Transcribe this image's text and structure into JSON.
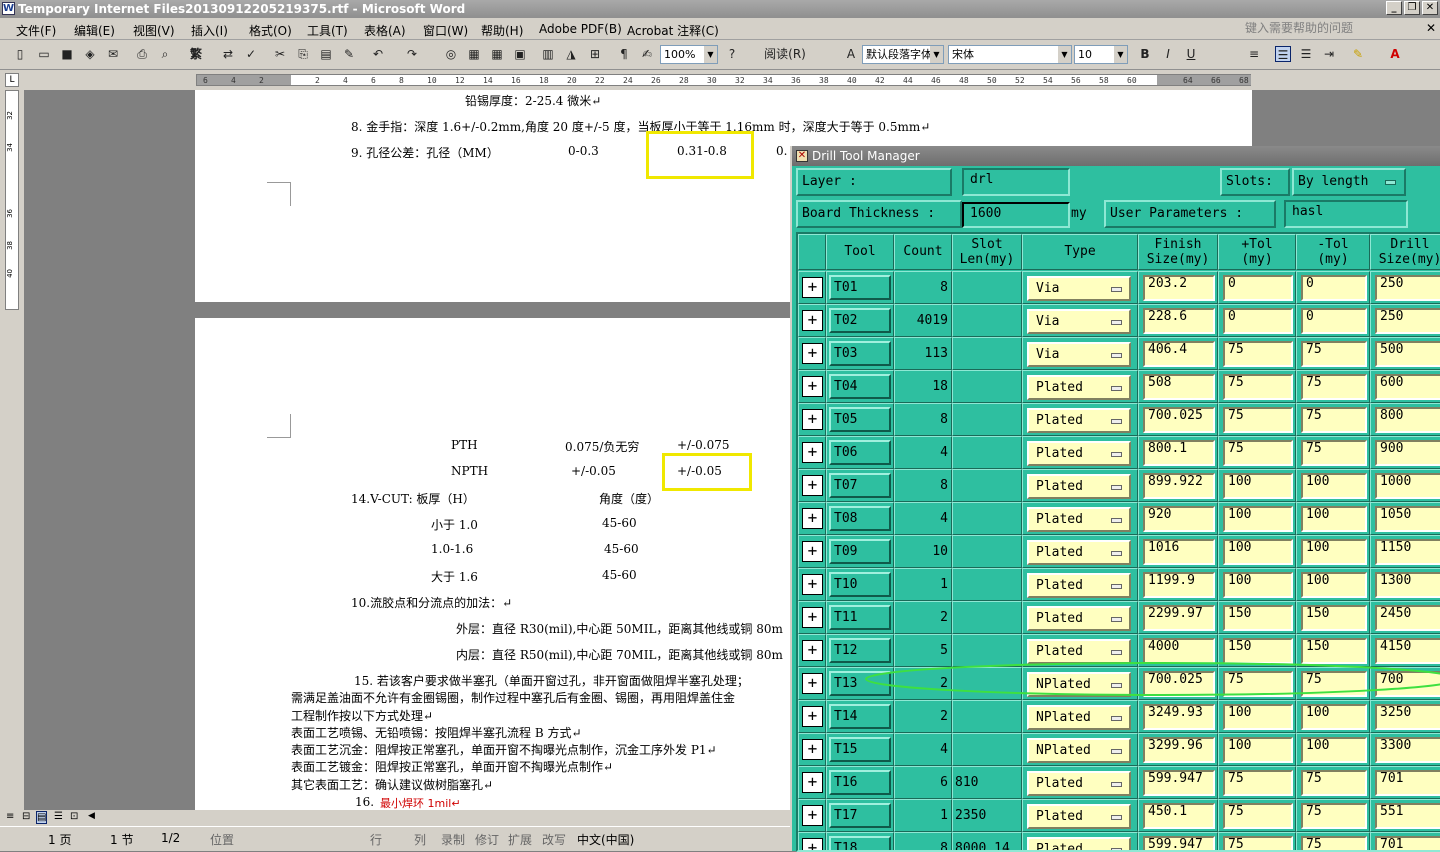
{
  "window": {
    "title": "Temporary Internet Files20130912205219375.rtf - Microsoft Word"
  },
  "menu": {
    "items": [
      "文件(F)",
      "编辑(E)",
      "视图(V)",
      "插入(I)",
      "格式(O)",
      "工具(T)",
      "表格(A)",
      "窗口(W)",
      "帮助(H)",
      "Adobe PDF(B)",
      "Acrobat 注释(C)"
    ],
    "help_placeholder": "键入需要帮助的问题"
  },
  "toolbar": {
    "zoom": "100%",
    "read_label": "阅读(R)",
    "style": "默认段落字体",
    "font": "宋体",
    "size": "10",
    "size2": "10",
    "fanti": "繁"
  },
  "ruler": {
    "ticks": [
      "6",
      "4",
      "2",
      "2",
      "4",
      "6",
      "8",
      "10",
      "12",
      "14",
      "16",
      "18",
      "20",
      "22",
      "24",
      "26",
      "28",
      "30",
      "32",
      "34",
      "36",
      "38",
      "40",
      "42",
      "44",
      "46",
      "48",
      "50",
      "52",
      "54",
      "56",
      "58",
      "60",
      "64",
      "66",
      "68"
    ]
  },
  "vruler": {
    "ticks": [
      "32",
      "34",
      "36",
      "38",
      "40",
      "42"
    ]
  },
  "document": {
    "p1_line1": "铅锡厚度：2-25.4 微米↵",
    "p1_line8": "8.  金手指：深度 1.6+/-0.2mm,角度 20 度+/-5 度，当板厚小于等于 1.16mm 时，深度大于等于 0.5mm↵",
    "p1_line9a": "9.  孔径公差：孔径（MM）",
    "p1_line9b": "0-0.3",
    "p1_line9c": "0.31-0.8",
    "p1_line9d": "0.",
    "pth": "PTH",
    "pth_val": "0.075/负无穷",
    "pth_val2": "+/-0.075",
    "npth": "NPTH",
    "npth_val": "+/-0.05",
    "npth_val2": "+/-0.05",
    "vcut": "14.V-CUT:  板厚（H）",
    "vcut_angle": "角度（度）",
    "r1a": "小于 1.0",
    "r1b": "45-60",
    "r2a": "1.0-1.6",
    "r2b": "45-60",
    "r3a": "大于 1.6",
    "r3b": "45-60",
    "l10": "10.流胶点和分流点的加法：↵",
    "l10a": "外层：直径 R30(mil),中心距 50MIL，距离其他线或铜 80m",
    "l10b": "内层：直径 R50(mil),中心距 70MIL，距离其他线或铜 80m",
    "l15": "15.  若该客户要求做半塞孔（单面开窗过孔，非开窗面做阻焊半塞孔处理；",
    "l15a": "需满足盖油面不允许有金圈锡圈，制作过程中塞孔后有金圈、锡圈，再用阻焊盖住金",
    "l15b": "工程制作按以下方式处理↵",
    "l15c": "表面工艺喷锡、无铅喷锡：按阻焊半塞孔流程 B 方式↵",
    "l15d": "表面工艺沉金：阻焊按正常塞孔，单面开窗不掏曝光点制作，沉金工序外发 P1↵",
    "l15e": "表面工艺镀金：阻焊按正常塞孔，单面开窗不掏曝光点制作↵",
    "l15f": "其它表面工艺：确认建议做树脂塞孔↵",
    "l16n": "16.",
    "l16": "最小焊环 1mil↵"
  },
  "status": {
    "page": "1 页",
    "section": "1 节",
    "pages": "1/2",
    "pos": "位置",
    "line": "行",
    "col": "列",
    "rec": "录制",
    "trk": "修订",
    "ext": "扩展",
    "ovr": "改写",
    "lang": "中文(中国)"
  },
  "dtm": {
    "title": "Drill Tool Manager",
    "layer_label": "Layer             :",
    "layer_value": "drl",
    "slots_label": "Slots:",
    "slots_value": "By length",
    "thickness_label": "Board Thickness  :",
    "thickness_value": "1600",
    "thickness_unit": "my",
    "user_params_label": "User Parameters :",
    "user_params_value": "hasl",
    "headers": {
      "tool": "Tool",
      "count": "Count",
      "slot1": "Slot",
      "slot2": "Len(my)",
      "type": "Type",
      "finish1": "Finish",
      "finish2": "Size(my)",
      "ptol1": "+Tol",
      "ptol2": "(my)",
      "mtol1": "-Tol",
      "mtol2": "(my)",
      "drill1": "Drill",
      "drill2": "Size(my)"
    },
    "rows": [
      {
        "tool": "T01",
        "count": "8",
        "slot": "",
        "type": "Via",
        "finish": "203.2",
        "ptol": "0",
        "mtol": "0",
        "drill": "250"
      },
      {
        "tool": "T02",
        "count": "4019",
        "slot": "",
        "type": "Via",
        "finish": "228.6",
        "ptol": "0",
        "mtol": "0",
        "drill": "250"
      },
      {
        "tool": "T03",
        "count": "113",
        "slot": "",
        "type": "Via",
        "finish": "406.4",
        "ptol": "75",
        "mtol": "75",
        "drill": "500"
      },
      {
        "tool": "T04",
        "count": "18",
        "slot": "",
        "type": "Plated",
        "finish": "508",
        "ptol": "75",
        "mtol": "75",
        "drill": "600"
      },
      {
        "tool": "T05",
        "count": "8",
        "slot": "",
        "type": "Plated",
        "finish": "700.025",
        "ptol": "75",
        "mtol": "75",
        "drill": "800"
      },
      {
        "tool": "T06",
        "count": "4",
        "slot": "",
        "type": "Plated",
        "finish": "800.1",
        "ptol": "75",
        "mtol": "75",
        "drill": "900"
      },
      {
        "tool": "T07",
        "count": "8",
        "slot": "",
        "type": "Plated",
        "finish": "899.922",
        "ptol": "100",
        "mtol": "100",
        "drill": "1000"
      },
      {
        "tool": "T08",
        "count": "4",
        "slot": "",
        "type": "Plated",
        "finish": "920",
        "ptol": "100",
        "mtol": "100",
        "drill": "1050"
      },
      {
        "tool": "T09",
        "count": "10",
        "slot": "",
        "type": "Plated",
        "finish": "1016",
        "ptol": "100",
        "mtol": "100",
        "drill": "1150"
      },
      {
        "tool": "T10",
        "count": "1",
        "slot": "",
        "type": "Plated",
        "finish": "1199.9",
        "ptol": "100",
        "mtol": "100",
        "drill": "1300"
      },
      {
        "tool": "T11",
        "count": "2",
        "slot": "",
        "type": "Plated",
        "finish": "2299.97",
        "ptol": "150",
        "mtol": "150",
        "drill": "2450"
      },
      {
        "tool": "T12",
        "count": "5",
        "slot": "",
        "type": "Plated",
        "finish": "4000",
        "ptol": "150",
        "mtol": "150",
        "drill": "4150"
      },
      {
        "tool": "T13",
        "count": "2",
        "slot": "",
        "type": "NPlated",
        "finish": "700.025",
        "ptol": "75",
        "mtol": "75",
        "drill": "700"
      },
      {
        "tool": "T14",
        "count": "2",
        "slot": "",
        "type": "NPlated",
        "finish": "3249.93",
        "ptol": "100",
        "mtol": "100",
        "drill": "3250"
      },
      {
        "tool": "T15",
        "count": "4",
        "slot": "",
        "type": "NPlated",
        "finish": "3299.96",
        "ptol": "100",
        "mtol": "100",
        "drill": "3300"
      },
      {
        "tool": "T16",
        "count": "6",
        "slot": "810",
        "type": "Plated",
        "finish": "599.947",
        "ptol": "75",
        "mtol": "75",
        "drill": "701"
      },
      {
        "tool": "T17",
        "count": "1",
        "slot": "2350",
        "type": "Plated",
        "finish": "450.1",
        "ptol": "75",
        "mtol": "75",
        "drill": "551"
      },
      {
        "tool": "T18",
        "count": "8",
        "slot": "8000.14",
        "type": "Plated",
        "finish": "599.947",
        "ptol": "75",
        "mtol": "75",
        "drill": "701"
      }
    ]
  }
}
